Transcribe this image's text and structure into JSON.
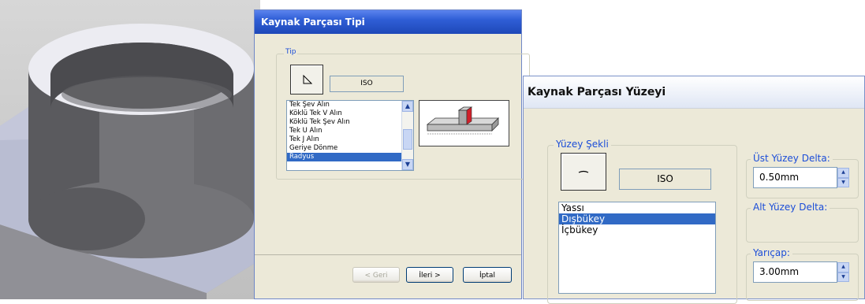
{
  "dialog_type": {
    "title": "Kaynak Parçası Tipi",
    "group_label": "Tip",
    "standard": "ISO",
    "type_icon": "fillet-weld-icon",
    "items": [
      {
        "label": "Tek Şev Alın",
        "selected": false
      },
      {
        "label": "Köklü Tek V Alın",
        "selected": false
      },
      {
        "label": "Köklü Tek Şev Alın",
        "selected": false
      },
      {
        "label": "Tek U Alın",
        "selected": false
      },
      {
        "label": "Tek J Alın",
        "selected": false
      },
      {
        "label": "Geriye Dönme",
        "selected": false
      },
      {
        "label": "Radyus",
        "selected": true
      }
    ],
    "buttons": {
      "back": "< Geri",
      "next": "İleri >",
      "cancel": "İptal"
    }
  },
  "dialog_surface": {
    "title": "Kaynak Parçası Yüzeyi",
    "shape_group_label": "Yüzey Şekli",
    "standard": "ISO",
    "shape_icon": "flat-surface-icon",
    "items": [
      {
        "label": "Yassı",
        "selected": false
      },
      {
        "label": "Dışbükey",
        "selected": true
      },
      {
        "label": "İçbükey",
        "selected": false
      }
    ],
    "top_delta_label": "Üst Yüzey Delta:",
    "top_delta_value": "0.50mm",
    "bottom_delta_label": "Alt Yüzey Delta:",
    "radius_label": "Yarıçap:",
    "radius_value": "3.00mm"
  },
  "colors": {
    "selection": "#316ac5",
    "legend": "#1b4dd8",
    "dialog_bg": "#ece9d8"
  }
}
